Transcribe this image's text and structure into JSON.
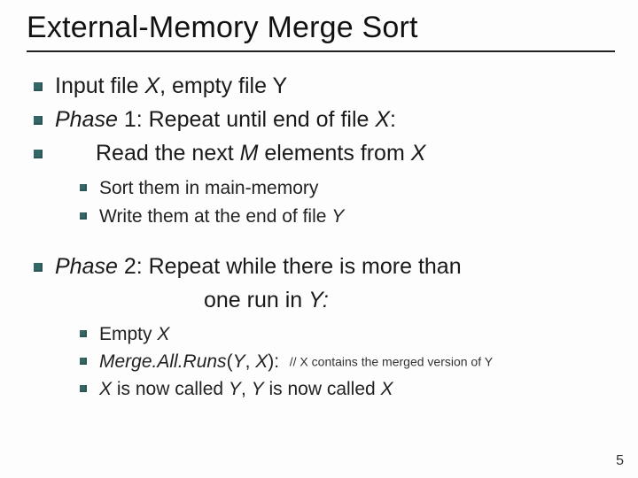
{
  "title": "External-Memory Merge Sort",
  "bullets": {
    "b1": {
      "pre": "Input file ",
      "x": "X",
      "mid": ", empty file Y"
    },
    "b2": {
      "phase": "Phase",
      "rest": " 1: Repeat until end of file ",
      "x": "X",
      "tail": ":"
    },
    "b3": {
      "pre": "Read the next ",
      "m": "M",
      "mid": " elements from ",
      "x": "X"
    },
    "s1": "Sort them in main-memory",
    "s2": {
      "pre": "Write them at the end of file ",
      "y": "Y"
    },
    "b4a": {
      "phase": "Phase",
      "rest": " 2: Repeat while there is more than"
    },
    "b4b": {
      "pre": "one run in ",
      "y": "Y:"
    },
    "s3": {
      "pre": "Empty ",
      "x": "X"
    },
    "s4": {
      "fn": "Merge.All.Runs",
      "args_open": "(",
      "y": "Y",
      "comma": ", ",
      "x": "X",
      "args_close": "):",
      "comment": "// X contains the merged version of Y"
    },
    "s5": {
      "x1": "X",
      "mid1": " is now called ",
      "y": "Y",
      "comma": ", ",
      "y2": "Y",
      "mid2": " is now called ",
      "x2": "X"
    }
  },
  "page_number": "5"
}
